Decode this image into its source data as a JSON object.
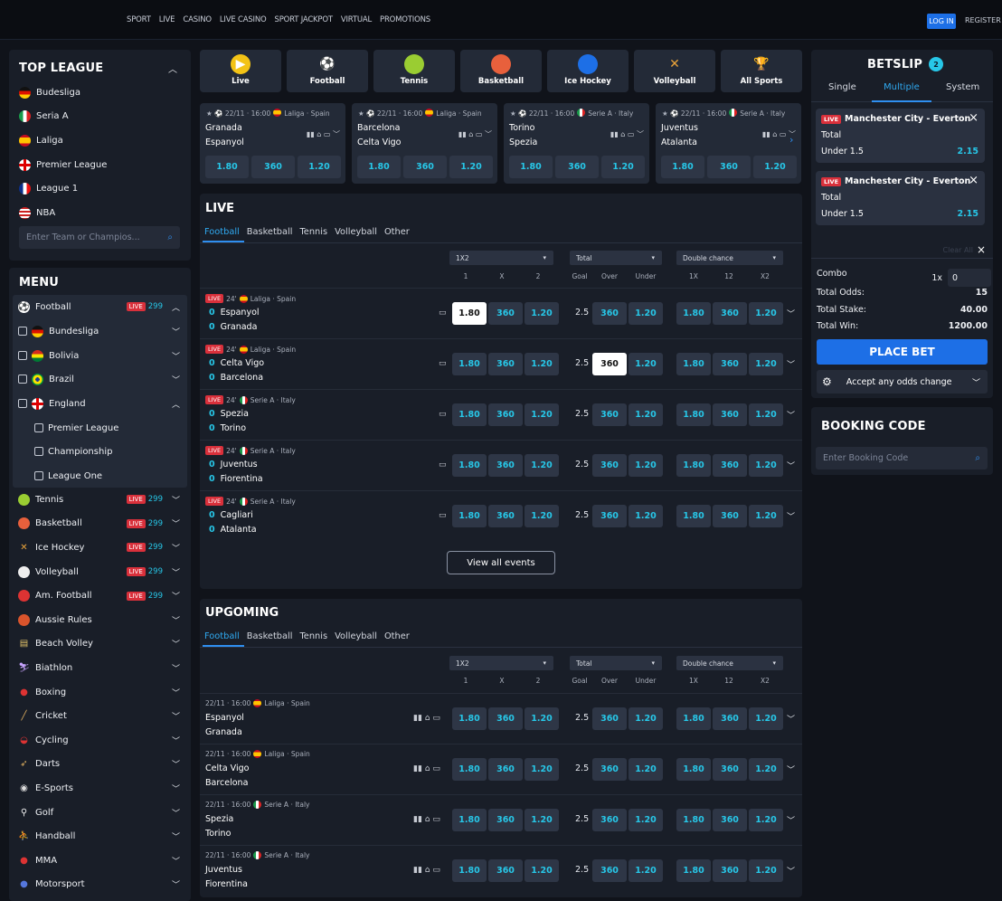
{
  "topnav": {
    "items": [
      "SPORT",
      "LIVE",
      "CASINO",
      "LIVE CASINO",
      "SPORT JACKPOT",
      "VIRTUAL",
      "PROMOTIONS"
    ],
    "login": "LOG IN",
    "register": "REGISTER"
  },
  "topleague": {
    "title": "TOP LEAGUE",
    "items": [
      "Budesliga",
      "Seria A",
      "Laliga",
      "Premier League",
      "League 1",
      "NBA"
    ],
    "search_placeholder": "Enter Team or Champios..."
  },
  "menu": {
    "title": "MENU",
    "football": {
      "label": "Football",
      "count": "299",
      "sub": [
        "Bundesliga",
        "Bolivia",
        "Brazil",
        "England"
      ],
      "england_sub": [
        "Premier League",
        "Championship",
        "League One"
      ]
    },
    "sports": [
      {
        "label": "Tennis",
        "count": "299"
      },
      {
        "label": "Basketball",
        "count": "299"
      },
      {
        "label": "Ice Hockey",
        "count": "299"
      },
      {
        "label": "Volleyball",
        "count": "299"
      },
      {
        "label": "Am. Football",
        "count": "299"
      },
      {
        "label": "Aussie Rules"
      },
      {
        "label": "Beach Volley"
      },
      {
        "label": "Biathlon"
      },
      {
        "label": "Boxing"
      },
      {
        "label": "Cricket"
      },
      {
        "label": "Cycling"
      },
      {
        "label": "Darts"
      },
      {
        "label": "E-Sports"
      },
      {
        "label": "Golf"
      },
      {
        "label": "Handball"
      },
      {
        "label": "MMA"
      },
      {
        "label": "Motorsport"
      }
    ],
    "live_label": "LIVE"
  },
  "sport_tiles": [
    "Live",
    "Football",
    "Tennis",
    "Basketball",
    "Ice Hockey",
    "Volleyball",
    "All Sports"
  ],
  "featured": [
    {
      "meta": "22/11 · 16:00",
      "league": "Laliga · Spain",
      "team1": "Granada",
      "team2": "Espanyol",
      "odds": [
        "1.80",
        "360",
        "1.20"
      ]
    },
    {
      "meta": "22/11 · 16:00",
      "league": "Laliga · Spain",
      "team1": "Barcelona",
      "team2": "Celta Vigo",
      "odds": [
        "1.80",
        "360",
        "1.20"
      ]
    },
    {
      "meta": "22/11 · 16:00",
      "league": "Serie A · Italy",
      "team1": "Torino",
      "team2": "Spezia",
      "odds": [
        "1.80",
        "360",
        "1.20"
      ]
    },
    {
      "meta": "22/11 · 16:00",
      "league": "Serie A · Italy",
      "team1": "Juventus",
      "team2": "Atalanta",
      "odds": [
        "1.80",
        "360",
        "1.20"
      ]
    }
  ],
  "live": {
    "title": "LIVE",
    "tabs": [
      "Football",
      "Basketball",
      "Tennis",
      "Volleyball",
      "Other"
    ],
    "dropdowns": [
      "1X2",
      "Total",
      "Double chance"
    ],
    "cols": [
      "1",
      "X",
      "2",
      "Goal",
      "Over",
      "Under",
      "1X",
      "12",
      "X2"
    ],
    "matches": [
      {
        "min": "24'",
        "league": "Laliga · Spain",
        "s1": "0",
        "t1": "Espanyol",
        "s2": "0",
        "t2": "Granada",
        "odds": [
          "1.80",
          "360",
          "1.20"
        ],
        "goal": "2.5",
        "tot": [
          "360",
          "1.20"
        ],
        "dc": [
          "1.80",
          "360",
          "1.20"
        ]
      },
      {
        "min": "24'",
        "league": "Laliga · Spain",
        "s1": "0",
        "t1": "Celta Vigo",
        "s2": "0",
        "t2": "Barcelona",
        "odds": [
          "1.80",
          "360",
          "1.20"
        ],
        "goal": "2.5",
        "tot": [
          "360",
          "1.20"
        ],
        "dc": [
          "1.80",
          "360",
          "1.20"
        ]
      },
      {
        "min": "24'",
        "league": "Serie A · Italy",
        "s1": "0",
        "t1": "Spezia",
        "s2": "0",
        "t2": "Torino",
        "odds": [
          "1.80",
          "360",
          "1.20"
        ],
        "goal": "2.5",
        "tot": [
          "360",
          "1.20"
        ],
        "dc": [
          "1.80",
          "360",
          "1.20"
        ]
      },
      {
        "min": "24'",
        "league": "Serie A · Italy",
        "s1": "0",
        "t1": "Juventus",
        "s2": "0",
        "t2": "Fiorentina",
        "odds": [
          "1.80",
          "360",
          "1.20"
        ],
        "goal": "2.5",
        "tot": [
          "360",
          "1.20"
        ],
        "dc": [
          "1.80",
          "360",
          "1.20"
        ]
      },
      {
        "min": "24'",
        "league": "Serie A · Italy",
        "s1": "0",
        "t1": "Cagliari",
        "s2": "0",
        "t2": "Atalanta",
        "odds": [
          "1.80",
          "360",
          "1.20"
        ],
        "goal": "2.5",
        "tot": [
          "360",
          "1.20"
        ],
        "dc": [
          "1.80",
          "360",
          "1.20"
        ]
      }
    ],
    "view_all": "View all events"
  },
  "upcoming": {
    "title": "UPGOMING",
    "tabs": [
      "Football",
      "Basketball",
      "Tennis",
      "Volleyball",
      "Other"
    ],
    "matches": [
      {
        "meta": "22/11 · 16:00",
        "league": "Laliga · Spain",
        "t1": "Espanyol",
        "t2": "Granada"
      },
      {
        "meta": "22/11 · 16:00",
        "league": "Laliga · Spain",
        "t1": "Celta Vigo",
        "t2": "Barcelona"
      },
      {
        "meta": "22/11 · 16:00",
        "league": "Serie A · Italy",
        "t1": "Spezia",
        "t2": "Torino"
      },
      {
        "meta": "22/11 · 16:00",
        "league": "Serie A · Italy",
        "t1": "Juventus",
        "t2": "Fiorentina"
      }
    ]
  },
  "betslip": {
    "title": "BETSLIP",
    "count": "2",
    "tabs": [
      "Single",
      "Multiple",
      "System"
    ],
    "bets": [
      {
        "match": "Manchester City - Everton",
        "market": "Total",
        "pick": "Under 1.5",
        "odds": "2.15"
      },
      {
        "match": "Manchester City - Everton",
        "market": "Total",
        "pick": "Under 1.5",
        "odds": "2.15"
      }
    ],
    "clear_all": "Clear All",
    "combo_label": "Combo",
    "combo_mult": "1x",
    "combo_value": "0",
    "total_odds_label": "Total Odds:",
    "total_odds": "15",
    "total_stake_label": "Total Stake:",
    "total_stake": "40.00",
    "total_win_label": "Total Win:",
    "total_win": "1200.00",
    "place_bet": "PLACE BET",
    "accept": "Accept any odds change"
  },
  "booking": {
    "title": "BOOKING CODE",
    "placeholder": "Enter Booking Code"
  }
}
